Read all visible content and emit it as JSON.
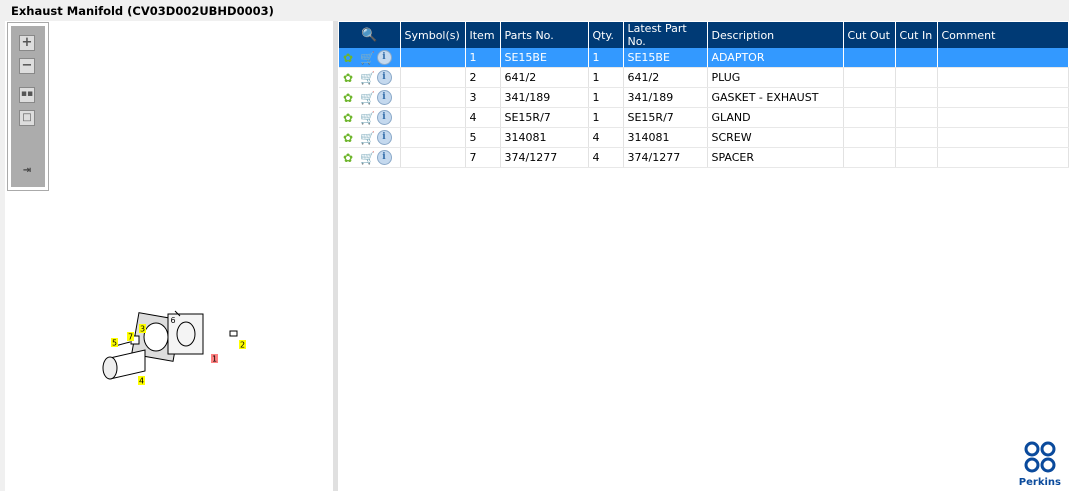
{
  "title": "Exhaust Manifold (CV03D002UBHD0003)",
  "toolbar": {
    "zoom_in": "+",
    "zoom_out": "−"
  },
  "table": {
    "headers": [
      "Symbol(s)",
      "Item",
      "Parts No.",
      "Qty.",
      "Latest Part No.",
      "Description",
      "Cut Out",
      "Cut In",
      "Comment"
    ],
    "rows": [
      {
        "item": "1",
        "part": "SE15BE",
        "qty": "1",
        "latest": "SE15BE",
        "desc": "ADAPTOR",
        "selected": true
      },
      {
        "item": "2",
        "part": "641/2",
        "qty": "1",
        "latest": "641/2",
        "desc": "PLUG"
      },
      {
        "item": "3",
        "part": "341/189",
        "qty": "1",
        "latest": "341/189",
        "desc": "GASKET - EXHAUST"
      },
      {
        "item": "4",
        "part": "SE15R/7",
        "qty": "1",
        "latest": "SE15R/7",
        "desc": "GLAND"
      },
      {
        "item": "5",
        "part": "314081",
        "qty": "4",
        "latest": "314081",
        "desc": "SCREW"
      },
      {
        "item": "7",
        "part": "374/1277",
        "qty": "4",
        "latest": "374/1277",
        "desc": "SPACER"
      }
    ]
  },
  "diagram": {
    "callouts": [
      "1",
      "2",
      "3",
      "4",
      "5",
      "6",
      "7"
    ]
  },
  "logo": {
    "text": "Perkins"
  },
  "colors": {
    "header": "#003a75",
    "selected": "#3399ff",
    "callout": "#ffff00",
    "callout_selected": "#ff8080"
  }
}
